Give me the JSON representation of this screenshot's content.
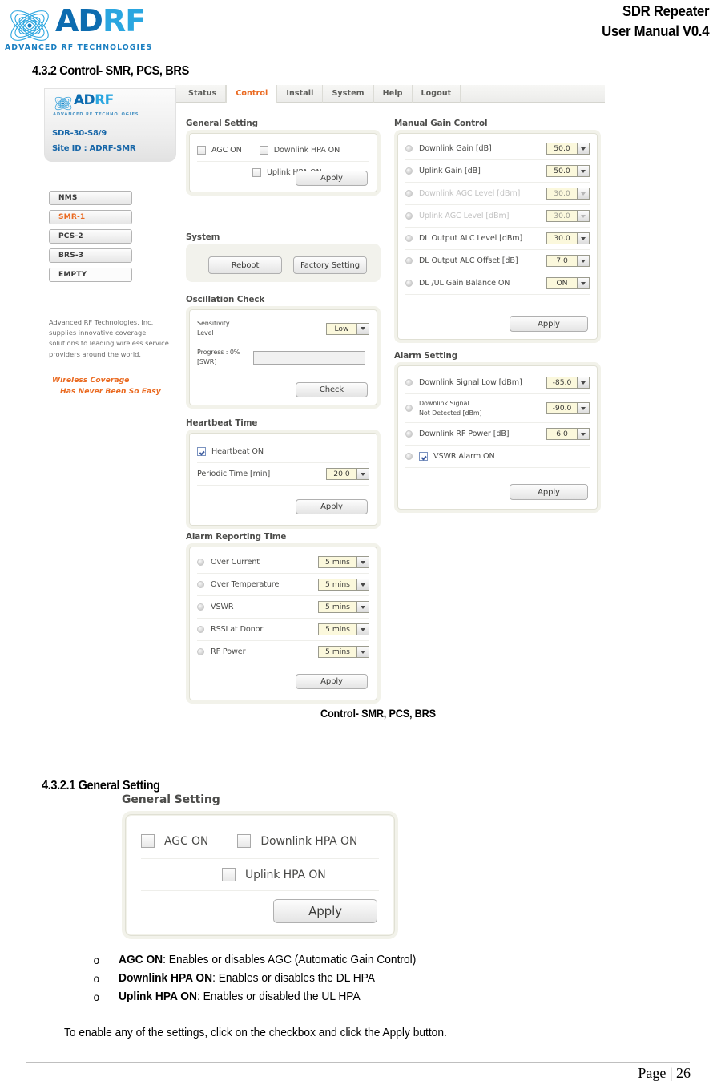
{
  "header": {
    "logo_name": "ADRF",
    "logo_ad": "AD",
    "logo_rf": "RF",
    "logo_tagline": "ADVANCED RF TECHNOLOGIES",
    "doc_title_line1": "SDR Repeater",
    "doc_title_line2": "User Manual V0.4"
  },
  "headings": {
    "section_432": "4.3.2 Control- SMR, PCS, BRS",
    "section_4321": "4.3.2.1 General Setting",
    "screenshot_caption": "Control- SMR, PCS, BRS"
  },
  "screenshot": {
    "nav_tabs": [
      {
        "label": "Status",
        "active": false
      },
      {
        "label": "Control",
        "active": true
      },
      {
        "label": "Install",
        "active": false
      },
      {
        "label": "System",
        "active": false
      },
      {
        "label": "Help",
        "active": false
      },
      {
        "label": "Logout",
        "active": false
      }
    ],
    "sidebar": {
      "logo_ad": "AD",
      "logo_rf": "RF",
      "logo_tagline": "ADVANCED RF TECHNOLOGIES",
      "model": "SDR-30-S8/9",
      "site_id": "Site ID : ADRF-SMR",
      "devices": [
        {
          "label": "NMS",
          "selected": false,
          "empty": false
        },
        {
          "label": "SMR-1",
          "selected": true,
          "empty": false
        },
        {
          "label": "PCS-2",
          "selected": false,
          "empty": false
        },
        {
          "label": "BRS-3",
          "selected": false,
          "empty": false
        },
        {
          "label": "EMPTY",
          "selected": false,
          "empty": true
        }
      ],
      "blurb": "Advanced RF Technologies, Inc. supplies innovative coverage solutions to leading wireless service providers around the world.",
      "slogan_line1": "Wireless Coverage",
      "slogan_line2": "Has Never Been So Easy"
    },
    "general_setting": {
      "title": "General Setting",
      "agc_on": "AGC ON",
      "downlink_hpa_on": "Downlink HPA ON",
      "uplink_hpa_on": "Uplink HPA ON",
      "apply": "Apply"
    },
    "system": {
      "title": "System",
      "reboot": "Reboot",
      "factory_setting": "Factory Setting"
    },
    "oscillation_check": {
      "title": "Oscillation Check",
      "sensitivity_label_line1": "Sensitivity",
      "sensitivity_label_line2": "Level",
      "sensitivity_value": "Low",
      "progress_label_line1": "Progress : 0%",
      "progress_label_line2": "[SWR]",
      "progress_percent": 0,
      "check": "Check"
    },
    "heartbeat_time": {
      "title": "Heartbeat Time",
      "heartbeat_on": "Heartbeat ON",
      "heartbeat_checked": true,
      "periodic_time_label": "Periodic Time [min]",
      "periodic_time_value": "20.0",
      "apply": "Apply"
    },
    "alarm_reporting_time": {
      "title": "Alarm Reporting Time",
      "rows": [
        {
          "label": "Over Current",
          "value": "5 mins"
        },
        {
          "label": "Over Temperature",
          "value": "5 mins"
        },
        {
          "label": "VSWR",
          "value": "5 mins"
        },
        {
          "label": "RSSI at Donor",
          "value": "5 mins"
        },
        {
          "label": "RF Power",
          "value": "5 mins"
        }
      ],
      "apply": "Apply"
    },
    "manual_gain_control": {
      "title": "Manual Gain Control",
      "rows": [
        {
          "label": "Downlink Gain  [dB]",
          "value": "50.0",
          "disabled": false
        },
        {
          "label": "Uplink Gain [dB]",
          "value": "50.0",
          "disabled": false
        },
        {
          "label": "Downlink AGC Level [dBm]",
          "value": "30.0",
          "disabled": true
        },
        {
          "label": "Uplink AGC Level  [dBm]",
          "value": "30.0",
          "disabled": true
        },
        {
          "label": "DL Output ALC Level  [dBm]",
          "value": "30.0",
          "disabled": false
        },
        {
          "label": "DL Output ALC Offset [dB]",
          "value": "7.0",
          "disabled": false
        },
        {
          "label": "DL /UL Gain Balance ON",
          "value": "ON",
          "disabled": false
        }
      ],
      "apply": "Apply"
    },
    "alarm_setting": {
      "title": "Alarm Setting",
      "row1_label": "Downlink Signal Low [dBm]",
      "row1_value": "-85.0",
      "row2_label_line1": "Downlink Signal",
      "row2_label_line2": "Not Detected [dBm]",
      "row2_value": "-90.0",
      "row3_label": "Downlink RF Power [dB]",
      "row3_value": "6.0",
      "vswr_alarm_on": "VSWR Alarm ON",
      "vswr_checked": true,
      "apply": "Apply"
    }
  },
  "general_setting_zoom": {
    "title": "General Setting",
    "agc_on": "AGC ON",
    "downlink_hpa_on": "Downlink HPA ON",
    "uplink_hpa_on": "Uplink HPA ON",
    "apply": "Apply"
  },
  "bullets": [
    {
      "marker": "o",
      "term": "AGC ON",
      "rest": ": Enables or disables AGC (Automatic Gain Control)"
    },
    {
      "marker": "o",
      "term": "Downlink HPA ON",
      "rest": ": Enables or disables the DL HPA"
    },
    {
      "marker": "o",
      "term": "Uplink HPA ON",
      "rest": ": Enables or disabled the UL HPA"
    }
  ],
  "closing_paragraph": "To enable any of the settings, click on the checkbox and click the Apply button.",
  "footer": {
    "page_number": "Page | 26"
  },
  "colors": {
    "brand_blue": "#0d6cb0",
    "brand_light_blue": "#2aa6e0",
    "accent_orange": "#ea6a21",
    "field_yellow": "#fbf8dc",
    "panel_bg": "#f2f2ec"
  }
}
